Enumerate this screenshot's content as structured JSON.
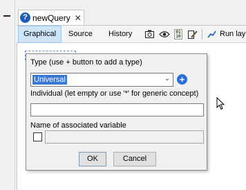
{
  "tab": {
    "icon": "help-icon",
    "icon_glyph": "?",
    "title": "newQuery",
    "close_glyph": "✕"
  },
  "toolbar": {
    "tabs": [
      {
        "label": "Graphical",
        "active": true
      },
      {
        "label": "Source",
        "active": false
      },
      {
        "label": "History",
        "active": false
      }
    ],
    "icons": [
      "camera-icon",
      "eye-icon",
      "binary-icon",
      "edit-icon"
    ],
    "binary_glyph": "01\n10",
    "run_label": "Run lay"
  },
  "dialog": {
    "type_label": "Type (use + button to add a type)",
    "type_value": "Universal",
    "add_button_glyph": "+",
    "individual_label": "Individual (let empty or use '*' for generic concept)",
    "individual_value": "",
    "variable_label": "Name of associated variable",
    "variable_checked": false,
    "variable_value": "",
    "ok_label": "OK",
    "cancel_label": "Cancel"
  }
}
